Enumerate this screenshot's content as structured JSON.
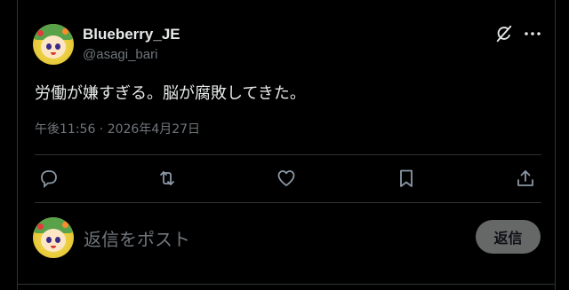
{
  "author": {
    "display_name": "Blueberry_JE",
    "handle": "@asagi_bari"
  },
  "header": {
    "grok_icon": "grok-icon",
    "more_icon": "more-horizontal-icon"
  },
  "post": {
    "text": "労働が嫌すぎる。脳が腐敗してきた。",
    "timestamp": "午後11:56 · 2026年4月27日"
  },
  "actions": [
    {
      "name": "reply",
      "icon": "comment-icon"
    },
    {
      "name": "repost",
      "icon": "retweet-icon"
    },
    {
      "name": "like",
      "icon": "heart-icon"
    },
    {
      "name": "bookmark",
      "icon": "bookmark-icon"
    },
    {
      "name": "share",
      "icon": "share-icon"
    }
  ],
  "composer": {
    "placeholder": "返信をポスト",
    "button_label": "返信"
  },
  "colors": {
    "background": "#000000",
    "text": "#e7e9ea",
    "muted": "#71767b",
    "divider": "#2f3336",
    "button_disabled": "#787a7a"
  }
}
